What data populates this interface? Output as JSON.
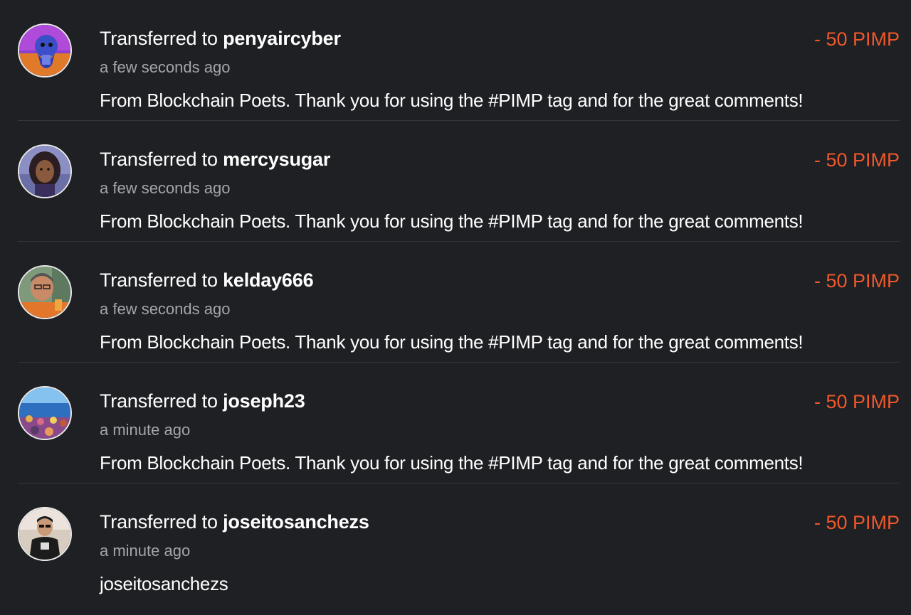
{
  "colors": {
    "background": "#1f2024",
    "amount": "#f0582a",
    "secondary_text": "#a3a5aa",
    "divider": "#33353a"
  },
  "transfers": [
    {
      "prefix": "Transferred to",
      "user": "penyaircyber",
      "time": "a few seconds ago",
      "memo": "From Blockchain Poets. Thank you for using the #PIMP tag and for the great comments!",
      "amount": "- 50 PIMP",
      "avatar": "penyaircyber-avatar"
    },
    {
      "prefix": "Transferred to",
      "user": "mercysugar",
      "time": "a few seconds ago",
      "memo": "From Blockchain Poets. Thank you for using the #PIMP tag and for the great comments!",
      "amount": "- 50 PIMP",
      "avatar": "mercysugar-avatar"
    },
    {
      "prefix": "Transferred to",
      "user": "kelday666",
      "time": "a few seconds ago",
      "memo": "From Blockchain Poets. Thank you for using the #PIMP tag and for the great comments!",
      "amount": "- 50 PIMP",
      "avatar": "kelday666-avatar"
    },
    {
      "prefix": "Transferred to",
      "user": "joseph23",
      "time": "a minute ago",
      "memo": "From Blockchain Poets. Thank you for using the #PIMP tag and for the great comments!",
      "amount": "- 50 PIMP",
      "avatar": "joseph23-avatar"
    },
    {
      "prefix": "Transferred to",
      "user": "joseitosanchezs",
      "time": "a minute ago",
      "memo": "joseitosanchezs",
      "amount": "- 50 PIMP",
      "avatar": "joseitosanchezs-avatar"
    }
  ]
}
